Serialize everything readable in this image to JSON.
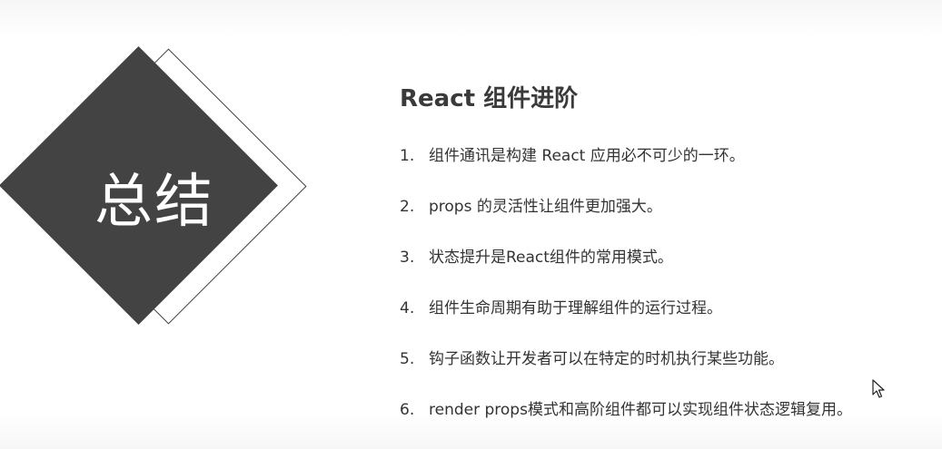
{
  "badge": {
    "title": "总结"
  },
  "section": {
    "title": "React 组件进阶"
  },
  "items": [
    {
      "num": "1.",
      "text": "组件通讯是构建 React 应用必不可少的一环。"
    },
    {
      "num": "2.",
      "text": "props 的灵活性让组件更加强大。"
    },
    {
      "num": "3.",
      "text": "状态提升是React组件的常用模式。"
    },
    {
      "num": "4.",
      "text": "组件生命周期有助于理解组件的运行过程。"
    },
    {
      "num": "5.",
      "text": "钩子函数让开发者可以在特定的时机执行某些功能。"
    },
    {
      "num": "6.",
      "text": "render props模式和高阶组件都可以实现组件状态逻辑复用。"
    }
  ],
  "colors": {
    "diamond": "#434343",
    "text": "#333333",
    "background": "#ffffff"
  },
  "icons": {
    "cursor": "mouse-pointer-icon"
  }
}
